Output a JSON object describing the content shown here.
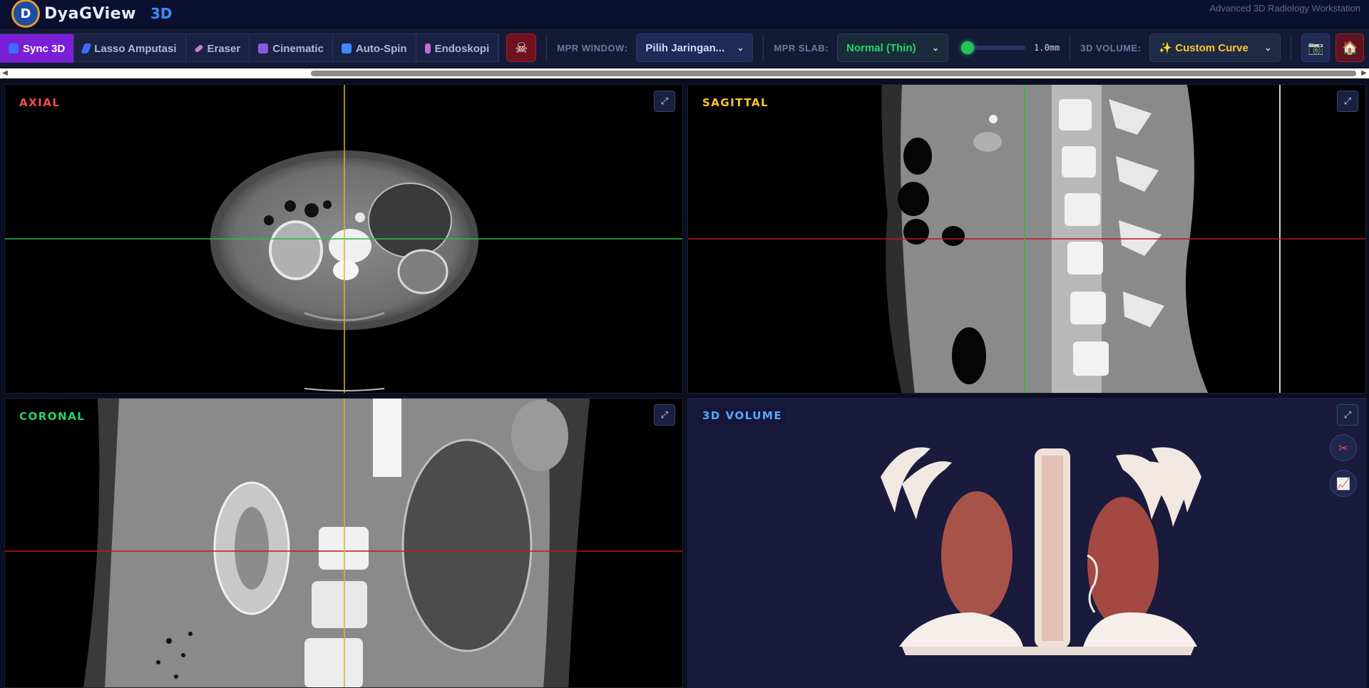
{
  "app": {
    "name": "DyaGView",
    "mode": "3D",
    "subtitle": "Advanced 3D Radiology Workstation"
  },
  "toolbar": {
    "tools": [
      {
        "label": "Sync 3D",
        "icon": "sync-icon",
        "active": true,
        "color": "#7a1fd6"
      },
      {
        "label": "Lasso Amputasi",
        "icon": "lasso-icon",
        "active": false
      },
      {
        "label": "Eraser",
        "icon": "eraser-icon",
        "active": false
      },
      {
        "label": "Cinematic",
        "icon": "film-icon",
        "active": false
      },
      {
        "label": "Auto-Spin",
        "icon": "spin-icon",
        "active": false
      },
      {
        "label": "Endoskopi",
        "icon": "endoscope-icon",
        "active": false
      }
    ],
    "skull_icon": "skull-icon",
    "mpr_window": {
      "label": "MPR WINDOW:",
      "value": "Pilih Jaringan..."
    },
    "mpr_slab": {
      "label": "MPR SLAB:",
      "value": "Normal (Thin)",
      "thickness": "1.0mm"
    },
    "volume": {
      "label": "3D VOLUME:",
      "value": "✨ Custom Curve"
    },
    "right_icons": [
      "camera-icon",
      "home-icon"
    ]
  },
  "viewports": {
    "axial": {
      "label": "AXIAL",
      "color": "#ff4d4d"
    },
    "sagittal": {
      "label": "SAGITTAL",
      "color": "#ffc72c"
    },
    "coronal": {
      "label": "CORONAL",
      "color": "#25d46b"
    },
    "volume": {
      "label": "3D VOLUME",
      "color": "#5aa4ff"
    }
  },
  "colors": {
    "crosshair_green": "#20c040",
    "crosshair_red": "#c01818",
    "crosshair_yellow": "#c8c020",
    "background": "#0a0e1f"
  }
}
